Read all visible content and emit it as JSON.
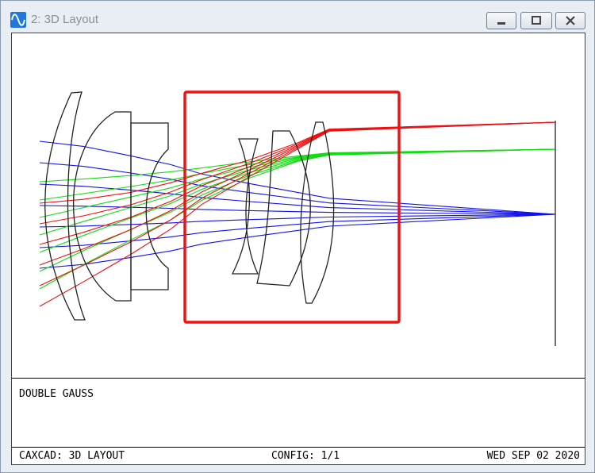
{
  "window": {
    "title": "2: 3D Layout",
    "icon": "sine-wave-icon",
    "controls": [
      "minimize-icon",
      "maximize-icon",
      "close-icon"
    ]
  },
  "layout_plot": {
    "rays": {
      "blue": "#1111ee",
      "green": "#11dd11",
      "red": "#ee1111"
    },
    "lens_color": "#222222",
    "highlight_color": "#ee1111"
  },
  "info": {
    "lens_title": "DOUBLE GAUSS"
  },
  "footer": {
    "left": "CAXCAD: 3D LAYOUT",
    "center": "CONFIG: 1/1",
    "right": "WED SEP 02 2020"
  }
}
